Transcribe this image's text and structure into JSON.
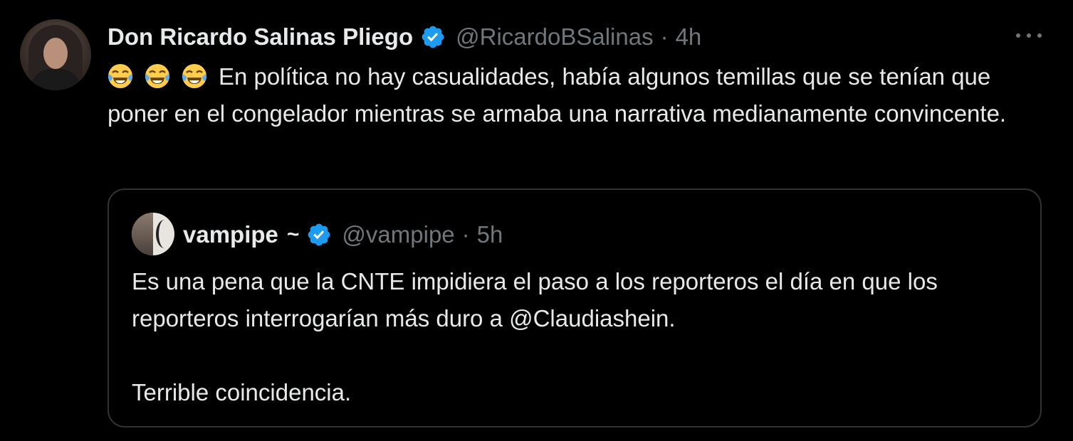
{
  "tweet": {
    "author_name": "Don Ricardo Salinas Pliego",
    "handle": "@RicardoBSalinas",
    "separator": "·",
    "time": "4h",
    "emojis": [
      "face-with-tears-of-joy",
      "face-with-tears-of-joy",
      "face-with-tears-of-joy"
    ],
    "text": "En política no hay casualidades, había algunos temillas que se tenían que poner en el congelador mientras se armaba una narrativa medianamente convincente."
  },
  "quoted_tweet": {
    "author_name": "vampipe",
    "name_suffix": "~",
    "handle": "@vampipe",
    "separator": "·",
    "time": "5h",
    "paragraph_1": "Es una pena que la CNTE impidiera el paso a los reporteros el día en que los reporteros interrogarían más duro a @Claudiashein.",
    "paragraph_2": "Terrible coincidencia."
  },
  "colors": {
    "background": "#000000",
    "text_primary": "#e7e9ea",
    "text_secondary": "#71767b",
    "verified_blue": "#1d9bf0",
    "border": "#2f3336"
  }
}
